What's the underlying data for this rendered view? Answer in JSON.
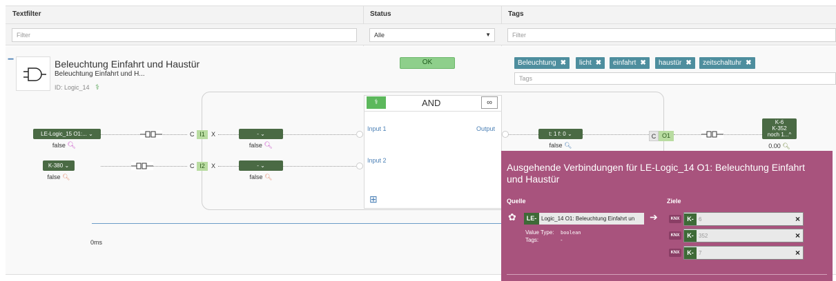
{
  "header": {
    "textfilter_label": "Textfilter",
    "status_label": "Status",
    "tags_label": "Tags",
    "textfilter_placeholder": "Filter",
    "status_value": "Alle",
    "tags_placeholder": "Filter"
  },
  "logic": {
    "collapse": "−",
    "title": "Beleuchtung Einfahrt und Haustür",
    "subtitle": "Beleuchtung Einfahrt und H...",
    "id_text": "ID: Logic_14",
    "status": "OK",
    "tags": [
      "Beleuchtung",
      "licht",
      "einfahrt",
      "haustür",
      "zeitschaltuhr"
    ],
    "tag_remove": "✖",
    "tags_input_placeholder": "Tags"
  },
  "diagram": {
    "input1_source": "LE-Logic_15 O1:...",
    "input1_value": "false",
    "input2_source": "K-380",
    "input2_value": "false",
    "c_label": "C",
    "i1_label": "I1",
    "i2_label": "I2",
    "x_label": "X",
    "filter1": "-",
    "filter1_value": "false",
    "filter2": "-",
    "filter2_value": "false",
    "gate_name": "AND",
    "input1_label": "Input 1",
    "input2_label": "Input 2",
    "output_label": "Output",
    "add_icon": "⊞",
    "link_icon": "∞",
    "output_filter": "t: 1 f: 0",
    "output_filter_value": "false",
    "o1_c_label": "C",
    "o1_label": "O1",
    "target_line1": "K-6",
    "target_line2": "K-352",
    "target_line3": "noch 1...",
    "target_value": "0.00",
    "delay": "0ms"
  },
  "popup": {
    "title": "Ausgehende Verbindungen für LE-Logic_14 O1: Beleuchtung Einfahrt und Haustür",
    "quelle_label": "Quelle",
    "ziele_label": "Ziele",
    "source_badge": "LE-",
    "source_text": "Logic_14 O1: Beleuchtung Einfahrt un",
    "value_type_label": "Value Type:",
    "value_type": "boolean",
    "tags_label": "Tags:",
    "tags_value": "-",
    "target_badge": "K-",
    "targets": [
      "6",
      "352",
      "7"
    ],
    "knx_label": "KNX",
    "remove": "×",
    "arrow": "➔"
  },
  "colors": {
    "popup_bg": "#a8537d",
    "node_green": "#4a6a44",
    "tag_teal": "#4e8e9e",
    "ok_green": "#8ecf8b"
  }
}
